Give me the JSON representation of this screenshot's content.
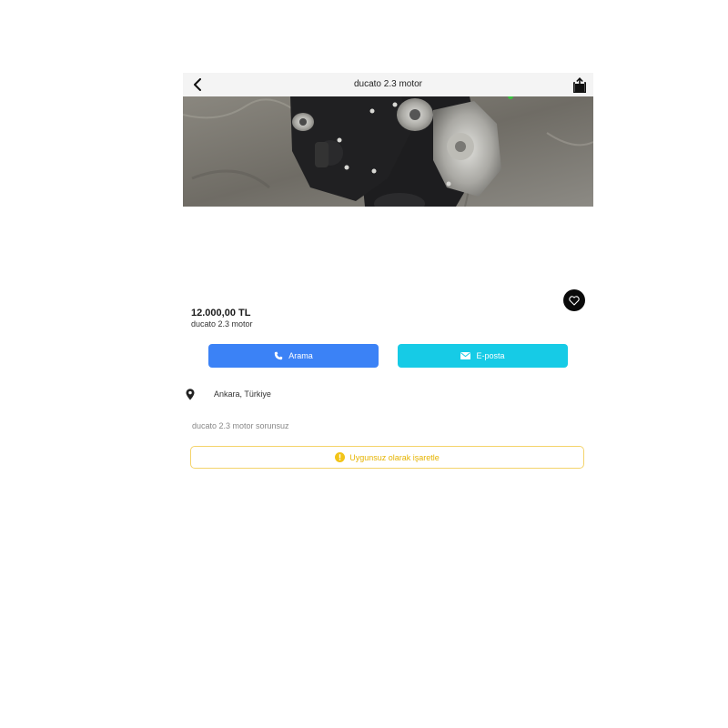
{
  "header": {
    "title": "ducato 2.3 motor",
    "back_icon": "chevron-left-icon",
    "share_icon": "share-icon"
  },
  "listing": {
    "price": "12.000,00 TL",
    "name": "ducato 2.3 motor",
    "location": "Ankara, Türkiye",
    "description": "ducato 2.3 motor sorunsuz"
  },
  "actions": {
    "call_label": "Arama",
    "email_label": "E-posta",
    "report_label": "Uygunsuz olarak işaretle"
  },
  "colors": {
    "call_button": "#3b82f6",
    "email_button": "#16cbe6",
    "report_accent": "#e6b400",
    "favorite_button": "#0a0a0a"
  }
}
